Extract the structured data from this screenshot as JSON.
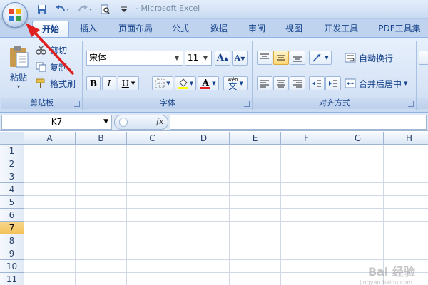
{
  "app": {
    "title": "- Microsoft Excel"
  },
  "qat": {
    "save_icon": "save-icon",
    "undo_icon": "undo-icon",
    "redo_icon": "redo-icon",
    "preview_icon": "print-preview-icon"
  },
  "tabs": [
    {
      "label": "开始",
      "active": true
    },
    {
      "label": "插入"
    },
    {
      "label": "页面布局"
    },
    {
      "label": "公式"
    },
    {
      "label": "数据"
    },
    {
      "label": "审阅"
    },
    {
      "label": "视图"
    },
    {
      "label": "开发工具"
    },
    {
      "label": "PDF工具集"
    }
  ],
  "ribbon": {
    "clipboard": {
      "label": "剪贴板",
      "paste": "粘贴",
      "cut": "剪切",
      "copy": "复制",
      "format_painter": "格式刷"
    },
    "font": {
      "label": "字体",
      "font_name": "宋体",
      "font_size": "11",
      "bold": "B",
      "italic": "I",
      "underline": "U",
      "font_color_glyph": "A",
      "grow": "A",
      "shrink": "A",
      "phonetic": "文",
      "phonetic_top": "wén"
    },
    "alignment": {
      "label": "对齐方式",
      "wrap_text": "自动换行",
      "merge_center": "合并后居中"
    }
  },
  "formula_bar": {
    "name_box": "K7",
    "fx": "fx",
    "formula": ""
  },
  "sheet": {
    "columns": [
      "A",
      "B",
      "C",
      "D",
      "E",
      "F",
      "G",
      "H"
    ],
    "rows": [
      "1",
      "2",
      "3",
      "4",
      "5",
      "6",
      "7",
      "8",
      "9",
      "10",
      "11"
    ],
    "selected_row": "7"
  },
  "watermark": {
    "text": "Bai 经验",
    "url": "jingyan.baidu.com"
  },
  "colors": {
    "accent": "#15428b",
    "selection": "#f3c15a",
    "arrow": "#e02020"
  }
}
